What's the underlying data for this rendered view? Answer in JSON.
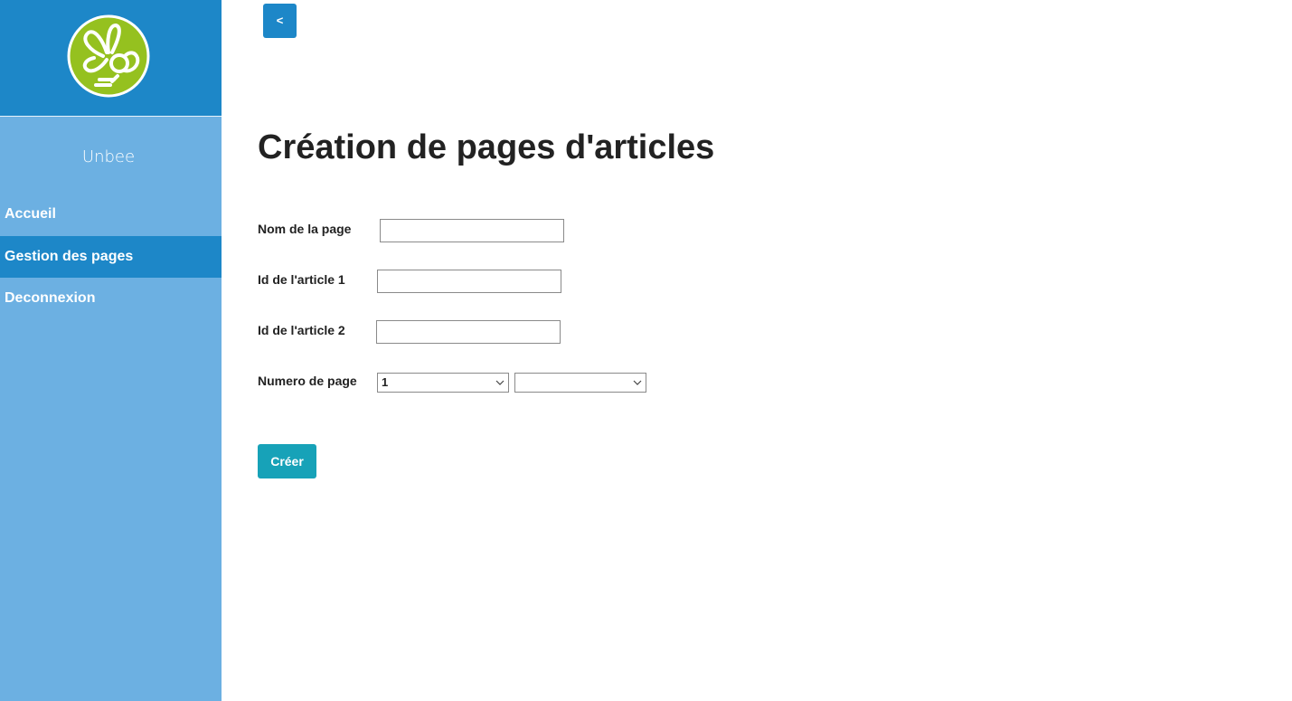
{
  "sidebar": {
    "logo_icon": "bee-logo-icon",
    "brand": "Unbee",
    "items": [
      {
        "label": "Accueil",
        "active": false
      },
      {
        "label": "Gestion des pages",
        "active": true
      },
      {
        "label": "Deconnexion",
        "active": false
      }
    ]
  },
  "header": {
    "back_label": "<"
  },
  "main": {
    "title": "Création de pages d'articles",
    "fields": {
      "page_name": {
        "label": "Nom de la page",
        "value": ""
      },
      "article1": {
        "label": "Id de l'article 1",
        "value": ""
      },
      "article2": {
        "label": "Id de l'article 2",
        "value": ""
      },
      "page_number": {
        "label": "Numero de page",
        "select1": "1",
        "select2": ""
      }
    },
    "submit_label": "Créer"
  },
  "colors": {
    "sidebar": "#6cb0e2",
    "sidebar_header": "#1d87c8",
    "active_item": "#1d87c8",
    "logo_green": "#95c11f",
    "submit": "#17a2b8"
  }
}
